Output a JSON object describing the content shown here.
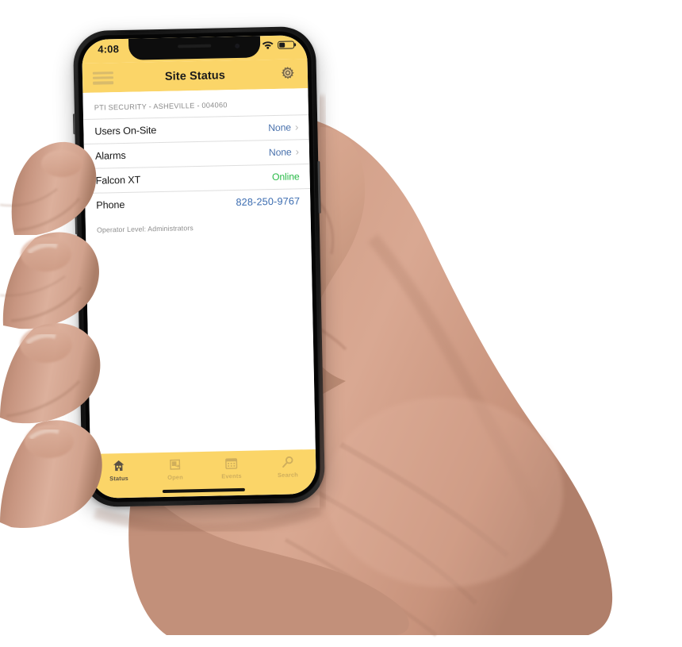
{
  "theme": {
    "brand_yellow": "#fbd568",
    "link_blue": "#4a72ad",
    "online_green": "#2bbb49",
    "phone_blue": "#3b6cb0",
    "muted_gray": "#8b8b8b"
  },
  "status_bar": {
    "time": "4:08",
    "signal_icon": "signal-dots-icon",
    "wifi_icon": "wifi-icon",
    "battery_icon": "battery-icon",
    "battery_level_pct": 36
  },
  "nav_bar": {
    "menu_icon": "hamburger-menu-icon",
    "title": "Site Status",
    "settings_icon": "gear-icon"
  },
  "content": {
    "site_header": "PTI SECURITY - ASHEVILLE - 004060",
    "rows": [
      {
        "label": "Users On-Site",
        "value": "None",
        "value_style": "blue",
        "chevron": "›",
        "has_chevron": true
      },
      {
        "label": "Alarms",
        "value": "None",
        "value_style": "blue",
        "chevron": "›",
        "has_chevron": true
      },
      {
        "label": "Falcon XT",
        "value": "Online",
        "value_style": "green",
        "chevron": "",
        "has_chevron": false
      },
      {
        "label": "Phone",
        "value": "828-250-9767",
        "value_style": "phone",
        "chevron": "",
        "has_chevron": false
      }
    ],
    "operator_level": "Operator Level: Administrators"
  },
  "tab_bar": {
    "tabs": [
      {
        "label": "Status",
        "icon": "home-icon",
        "active": true
      },
      {
        "label": "Open",
        "icon": "door-open-icon",
        "active": false
      },
      {
        "label": "Events",
        "icon": "calendar-icon",
        "active": false
      },
      {
        "label": "Search",
        "icon": "magnifier-icon",
        "active": false
      }
    ]
  }
}
